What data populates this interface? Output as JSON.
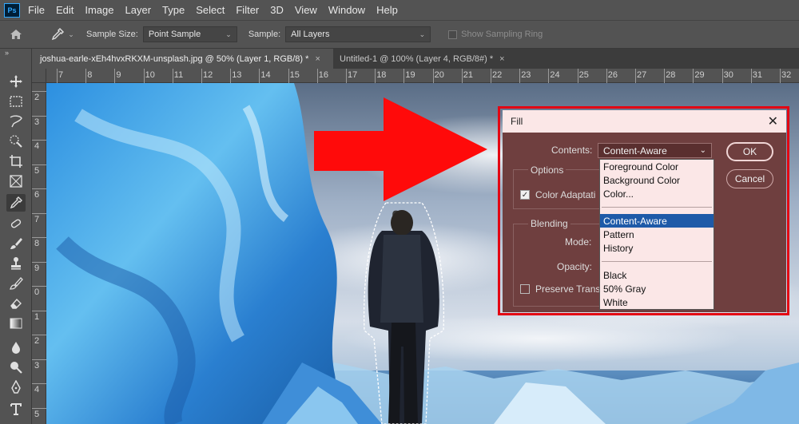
{
  "app": {
    "logo": "Ps"
  },
  "menu": [
    "File",
    "Edit",
    "Image",
    "Layer",
    "Type",
    "Select",
    "Filter",
    "3D",
    "View",
    "Window",
    "Help"
  ],
  "options": {
    "sample_size_label": "Sample Size:",
    "sample_size_value": "Point Sample",
    "sample_label": "Sample:",
    "sample_value": "All Layers",
    "show_ring_label": "Show Sampling Ring"
  },
  "tabs": [
    {
      "label": "joshua-earle-xEh4hvxRKXM-unsplash.jpg @ 50% (Layer 1, RGB/8) *",
      "close": "×"
    },
    {
      "label": "Untitled-1 @ 100% (Layer 4, RGB/8#) *",
      "close": "×"
    }
  ],
  "ruler_top": [
    "7",
    "8",
    "9",
    "10",
    "11",
    "12",
    "13",
    "14",
    "15",
    "16",
    "17",
    "18",
    "19",
    "20",
    "21",
    "22",
    "23",
    "24",
    "25",
    "26",
    "27",
    "28",
    "29",
    "30",
    "31",
    "32"
  ],
  "ruler_left": [
    "2",
    "3",
    "4",
    "5",
    "6",
    "7",
    "8",
    "9",
    "0",
    "1",
    "2",
    "3",
    "4",
    "5"
  ],
  "fill_dialog": {
    "title": "Fill",
    "close": "✕",
    "contents_label": "Contents:",
    "contents_value": "Content-Aware",
    "options_label": "Options",
    "color_adaptation_label": "Color Adaptati",
    "blending_label": "Blending",
    "mode_label": "Mode:",
    "opacity_label": "Opacity:",
    "preserve_label": "Preserve Trans",
    "ok": "OK",
    "cancel": "Cancel",
    "dropdown": {
      "group1": [
        "Foreground Color",
        "Background Color",
        "Color..."
      ],
      "group2": [
        "Content-Aware",
        "Pattern",
        "History"
      ],
      "group3": [
        "Black",
        "50% Gray",
        "White"
      ],
      "selected": "Content-Aware"
    }
  },
  "colors": {
    "highlight": "#e30613",
    "arrow": "#ff0a0a",
    "selection": "#1e5aa8"
  }
}
